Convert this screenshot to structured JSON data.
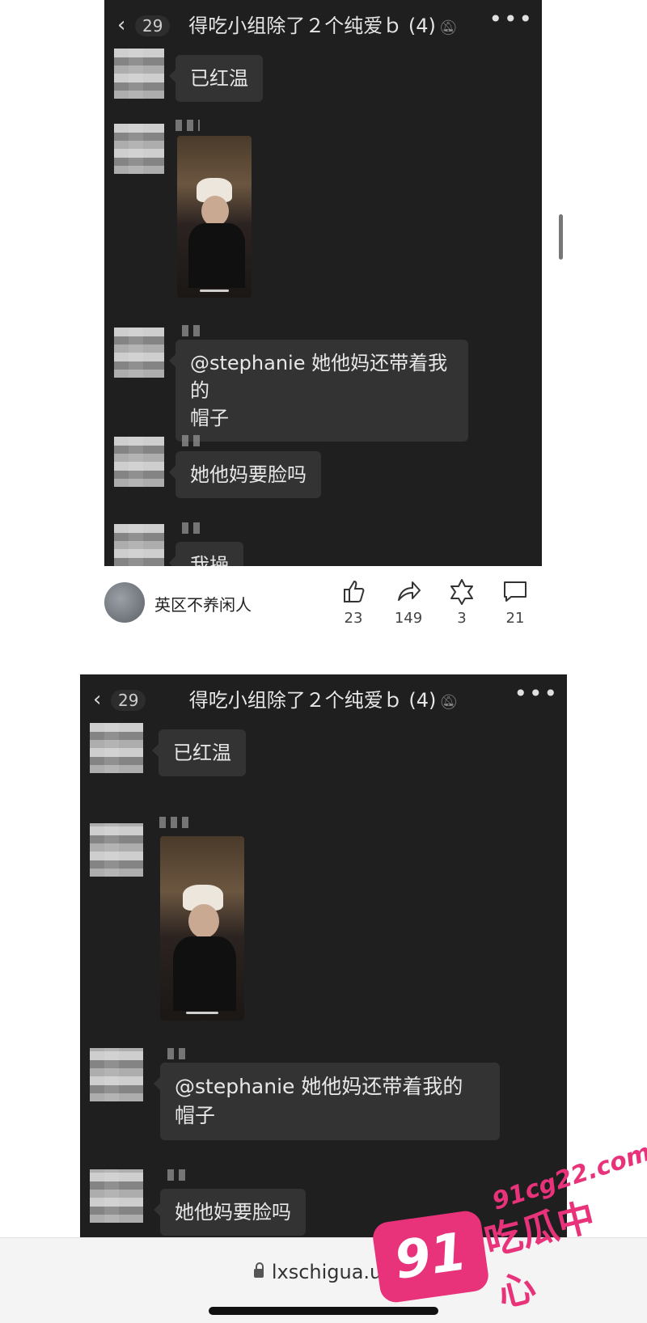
{
  "chat": {
    "unread_count": "29",
    "title": "得吃小组除了２个纯爱ｂ (4)",
    "messages": {
      "m1": "已红温",
      "m3_line1": "@stephanie 她他妈还带着我的",
      "m3_line2": "帽子",
      "m4": "她他妈要脸吗",
      "m5": "我操"
    }
  },
  "post": {
    "author": "英区不养闲人",
    "likes": "23",
    "shares": "149",
    "favorites": "3",
    "comments": "21"
  },
  "browser": {
    "url": "lxschigua.uk"
  },
  "watermark": {
    "badge": "91",
    "domain": "91cg22.com",
    "brand": "吃瓜中心"
  },
  "icons": {
    "back": "chevron-left-icon",
    "mute": "bell-slash-icon",
    "more": "more-dots-icon",
    "like": "thumbs-up-icon",
    "share": "share-arrow-icon",
    "favorite": "star-hexagon-icon",
    "comment": "speech-bubble-icon",
    "lock": "lock-icon"
  },
  "colors": {
    "chat_bg": "#1f1f1f",
    "bubble_bg": "#333333",
    "watermark": "#e8327a"
  }
}
